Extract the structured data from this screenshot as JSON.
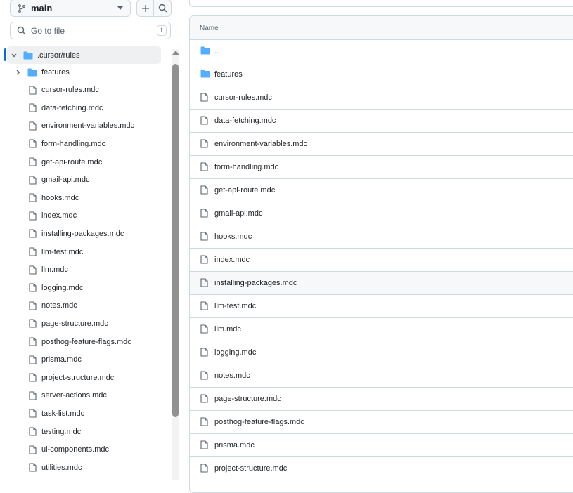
{
  "branch": {
    "name": "main"
  },
  "search": {
    "placeholder": "Go to file",
    "shortcut": "t"
  },
  "tree": {
    "root": {
      "label": ".cursor/rules"
    },
    "items": [
      {
        "label": "features",
        "kind": "folder"
      },
      {
        "label": "cursor-rules.mdc",
        "kind": "file"
      },
      {
        "label": "data-fetching.mdc",
        "kind": "file"
      },
      {
        "label": "environment-variables.mdc",
        "kind": "file"
      },
      {
        "label": "form-handling.mdc",
        "kind": "file"
      },
      {
        "label": "get-api-route.mdc",
        "kind": "file"
      },
      {
        "label": "gmail-api.mdc",
        "kind": "file"
      },
      {
        "label": "hooks.mdc",
        "kind": "file"
      },
      {
        "label": "index.mdc",
        "kind": "file"
      },
      {
        "label": "installing-packages.mdc",
        "kind": "file"
      },
      {
        "label": "llm-test.mdc",
        "kind": "file"
      },
      {
        "label": "llm.mdc",
        "kind": "file"
      },
      {
        "label": "logging.mdc",
        "kind": "file"
      },
      {
        "label": "notes.mdc",
        "kind": "file"
      },
      {
        "label": "page-structure.mdc",
        "kind": "file"
      },
      {
        "label": "posthog-feature-flags.mdc",
        "kind": "file"
      },
      {
        "label": "prisma.mdc",
        "kind": "file"
      },
      {
        "label": "project-structure.mdc",
        "kind": "file"
      },
      {
        "label": "server-actions.mdc",
        "kind": "file"
      },
      {
        "label": "task-list.mdc",
        "kind": "file"
      },
      {
        "label": "testing.mdc",
        "kind": "file"
      },
      {
        "label": "ui-components.mdc",
        "kind": "file"
      },
      {
        "label": "utilities.mdc",
        "kind": "file"
      }
    ]
  },
  "table": {
    "header_name": "Name",
    "rows": [
      {
        "name": "..",
        "kind": "folder"
      },
      {
        "name": "features",
        "kind": "folder"
      },
      {
        "name": "cursor-rules.mdc",
        "kind": "file"
      },
      {
        "name": "data-fetching.mdc",
        "kind": "file"
      },
      {
        "name": "environment-variables.mdc",
        "kind": "file"
      },
      {
        "name": "form-handling.mdc",
        "kind": "file"
      },
      {
        "name": "get-api-route.mdc",
        "kind": "file"
      },
      {
        "name": "gmail-api.mdc",
        "kind": "file"
      },
      {
        "name": "hooks.mdc",
        "kind": "file"
      },
      {
        "name": "index.mdc",
        "kind": "file"
      },
      {
        "name": "installing-packages.mdc",
        "kind": "file"
      },
      {
        "name": "llm-test.mdc",
        "kind": "file"
      },
      {
        "name": "llm.mdc",
        "kind": "file"
      },
      {
        "name": "logging.mdc",
        "kind": "file"
      },
      {
        "name": "notes.mdc",
        "kind": "file"
      },
      {
        "name": "page-structure.mdc",
        "kind": "file"
      },
      {
        "name": "posthog-feature-flags.mdc",
        "kind": "file"
      },
      {
        "name": "prisma.mdc",
        "kind": "file"
      },
      {
        "name": "project-structure.mdc",
        "kind": "file"
      }
    ]
  },
  "colors": {
    "accent": "#0969da",
    "folder": "#54aeff",
    "border": "#d1d9e0"
  }
}
